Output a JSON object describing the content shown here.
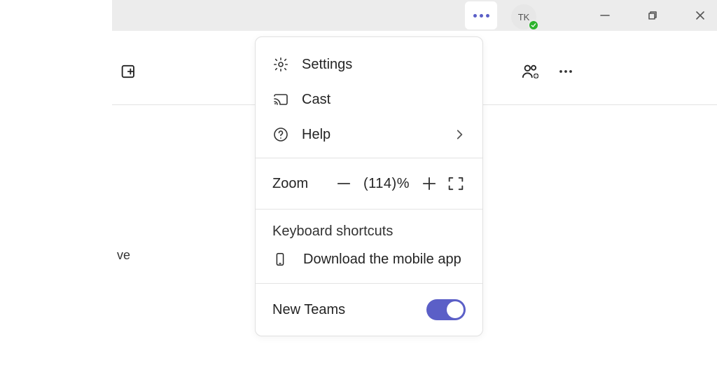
{
  "titlebar": {
    "avatar_initials": "TK",
    "presence": "available"
  },
  "header": {
    "more_menu_open": true
  },
  "stray": {
    "left_text_fragment": "ve"
  },
  "popover": {
    "settings_label": "Settings",
    "cast_label": "Cast",
    "help_label": "Help",
    "zoom_label": "Zoom",
    "zoom_value_text": "(114)%",
    "shortcuts_label": "Keyboard shortcuts",
    "download_label": "Download the mobile app",
    "new_teams_label": "New Teams",
    "new_teams_on": true
  }
}
